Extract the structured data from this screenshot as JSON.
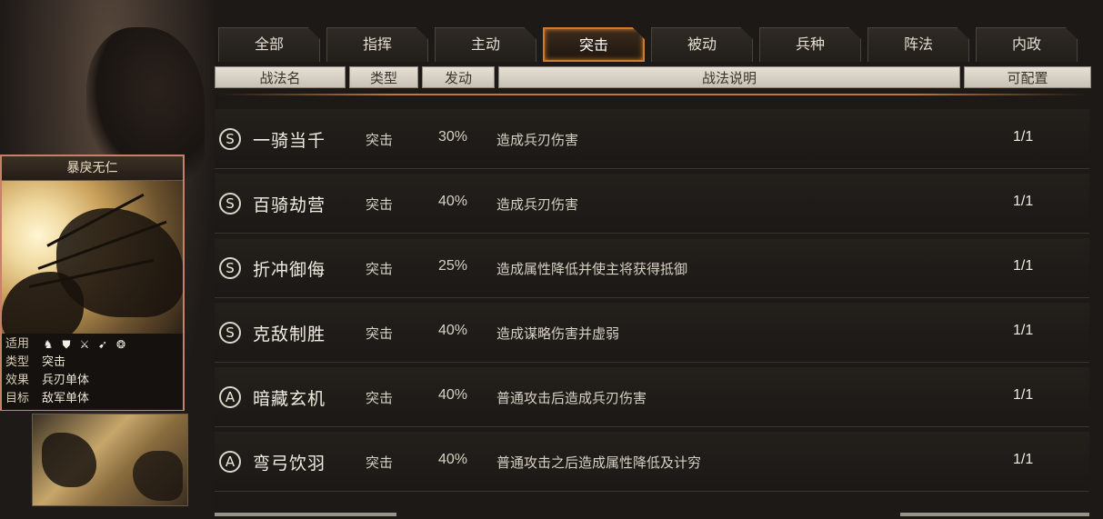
{
  "tabs": [
    {
      "label": "全部"
    },
    {
      "label": "指挥"
    },
    {
      "label": "主动"
    },
    {
      "label": "突击",
      "active": true
    },
    {
      "label": "被动"
    },
    {
      "label": "兵种"
    },
    {
      "label": "阵法"
    },
    {
      "label": "内政"
    }
  ],
  "columns": {
    "name": "战法名",
    "type": "类型",
    "trigger": "发动",
    "description": "战法说明",
    "slots": "可配置"
  },
  "skills": [
    {
      "grade": "S",
      "name": "一骑当千",
      "type": "突击",
      "rate": "30%",
      "description": "造成兵刃伤害",
      "slots": "1/1"
    },
    {
      "grade": "S",
      "name": "百骑劫营",
      "type": "突击",
      "rate": "40%",
      "description": "造成兵刃伤害",
      "slots": "1/1"
    },
    {
      "grade": "S",
      "name": "折冲御侮",
      "type": "突击",
      "rate": "25%",
      "description": "造成属性降低并使主将获得抵御",
      "slots": "1/1"
    },
    {
      "grade": "S",
      "name": "克敌制胜",
      "type": "突击",
      "rate": "40%",
      "description": "造成谋略伤害并虚弱",
      "slots": "1/1"
    },
    {
      "grade": "A",
      "name": "暗藏玄机",
      "type": "突击",
      "rate": "40%",
      "description": "普通攻击后造成兵刃伤害",
      "slots": "1/1"
    },
    {
      "grade": "A",
      "name": "弯弓饮羽",
      "type": "突击",
      "rate": "40%",
      "description": "普通攻击之后造成属性降低及计穷",
      "slots": "1/1"
    }
  ],
  "detail_card": {
    "title": "暴戾无仁",
    "applies_label": "适用",
    "applies_icons": [
      "cavalry-icon",
      "shield-icon",
      "crossed-swords-icon",
      "bow-icon",
      "siege-icon"
    ],
    "type_label": "类型",
    "type_value": "突击",
    "effect_label": "效果",
    "effect_value": "兵刃单体",
    "target_label": "目标",
    "target_value": "敌军单体"
  },
  "colors": {
    "active_tab_border": "#d07a2a",
    "card_border": "#c8806a"
  }
}
